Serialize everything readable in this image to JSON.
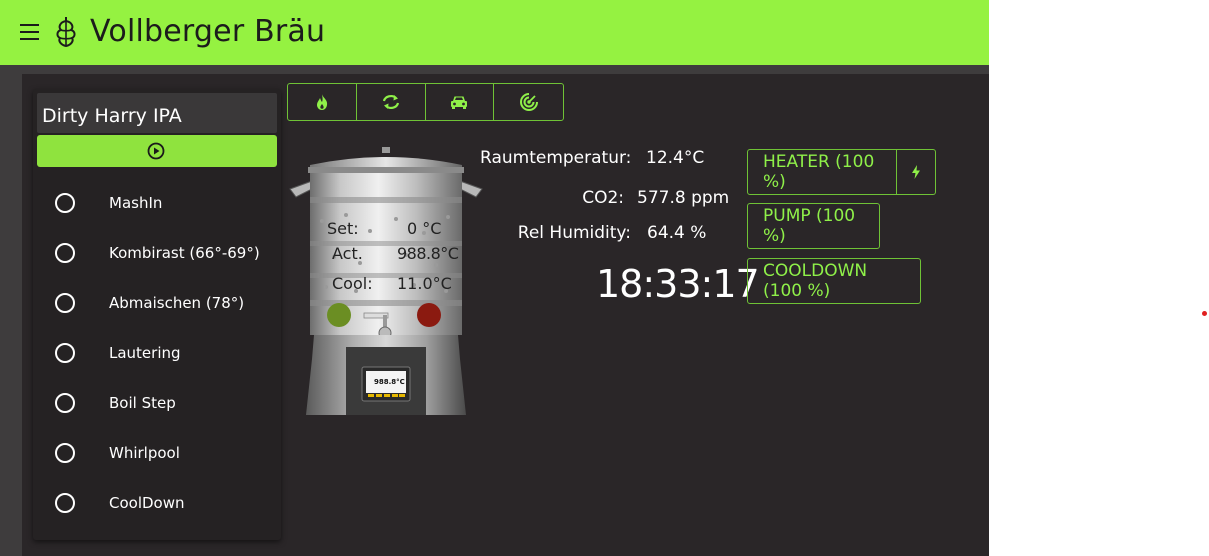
{
  "header": {
    "title": "Vollberger Bräu",
    "menu_icon": "hamburger-menu-icon",
    "logo_icon": "hop-icon",
    "accent_color": "#95f241"
  },
  "recipe": {
    "name": "Dirty Harry IPA",
    "start_icon": "play-circle-icon",
    "steps": [
      {
        "label": "MashIn"
      },
      {
        "label": "Kombirast (66°-69°)"
      },
      {
        "label": "Abmaischen (78°)"
      },
      {
        "label": "Lautering"
      },
      {
        "label": "Boil Step"
      },
      {
        "label": "Whirlpool"
      },
      {
        "label": "CoolDown"
      }
    ]
  },
  "toolbar": {
    "icons": [
      "flame-icon",
      "refresh-icon",
      "car-icon",
      "target-icon"
    ]
  },
  "kettle": {
    "set_label": "Set:",
    "set_value": "0 °C",
    "act_label": "Act.",
    "act_value": "988.8°C",
    "cool_label": "Cool:",
    "cool_value": "11.0°C",
    "display_value": "988.8°C",
    "lamp_left_color": "#6b8e23",
    "lamp_right_color": "#8b1a10"
  },
  "sensors": {
    "room_temp_label": "Raumtemperatur:",
    "room_temp_value": "12.4°C",
    "co2_label": "CO2:",
    "co2_value": "577.8 ppm",
    "humidity_label": "Rel Humidity:",
    "humidity_value": "64.4 %",
    "clock": "18:33:17"
  },
  "controls": {
    "heater_label": "HEATER (100 %)",
    "heater_extra_icon": "lightning-bolt-icon",
    "pump_label": "PUMP (100 %)",
    "cooldown_label": "COOLDOWN (100 %)"
  }
}
